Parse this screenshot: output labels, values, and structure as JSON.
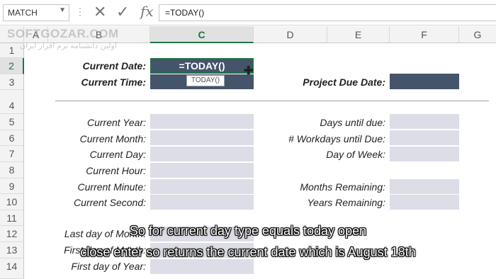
{
  "formula_bar": {
    "name_box": "MATCH",
    "formula": "=TODAY()",
    "cancel_icon": "close-icon",
    "enter_icon": "check-icon",
    "fx_icon": "function-icon"
  },
  "columns": [
    "A",
    "B",
    "C",
    "D",
    "E",
    "F",
    "G"
  ],
  "rows": [
    "1",
    "2",
    "3",
    "4",
    "5",
    "6",
    "7",
    "8",
    "9",
    "10",
    "11",
    "12",
    "13",
    "14"
  ],
  "sheet": {
    "current_date_label": "Current Date:",
    "current_time_label": "Current Time:",
    "project_due_label": "Project Due Date:",
    "active_cell_text": "=TODAY()",
    "tooltip_text": "TODAY()",
    "left_labels": [
      "Current Year:",
      "Current Month:",
      "Current Day:",
      "Current Hour:",
      "Current Minute:",
      "Current Second:",
      "Last day of Month:",
      "First day of Month:",
      "First day of Year:"
    ],
    "right_labels": [
      "Days until due:",
      "# Workdays until Due:",
      "Day of Week:",
      "Months Remaining:",
      "Years Remaining:"
    ]
  },
  "subtitles": {
    "line1": "So for current day type equals today open",
    "line2": "close enter so returns the current date which is August 18th"
  },
  "watermark": {
    "line1": "SOFTGOZAR.COM",
    "line2": "اولین دانشنامه نرم افزار ایران"
  },
  "colors": {
    "accent": "#217346",
    "dark_cell": "#44546a",
    "input_cell": "#dcdde6"
  }
}
